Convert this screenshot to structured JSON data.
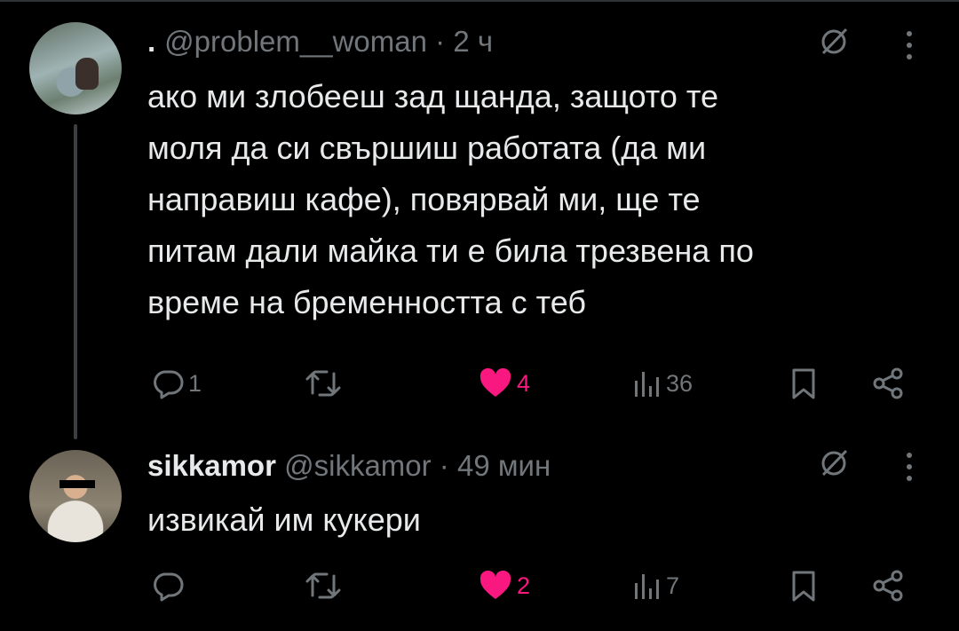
{
  "replies": [
    {
      "lead": ".",
      "display_name": "",
      "handle": "@problem__woman",
      "separator": "·",
      "time": "2 ч",
      "text_lines": [
        "ако ми злобееш зад щанда, защото те",
        "моля да си свършиш работата (да ми",
        "направиш кафе), повярвай ми, ще те",
        "питам дали майка ти е била трезвена по",
        "време на бременността с теб"
      ],
      "stats": {
        "replies": "1",
        "reposts": "",
        "likes": "4",
        "views": "36",
        "liked": true
      }
    },
    {
      "display_name": "sikkamor",
      "handle": "@sikkamor",
      "separator": "·",
      "time": "49 мин",
      "text": "извикай им кукери",
      "stats": {
        "replies": "",
        "reposts": "",
        "likes": "2",
        "views": "7",
        "liked": true
      }
    }
  ],
  "icons": {
    "reply": "speech-bubble-icon",
    "repost": "repost-arrows-icon",
    "like": "heart-icon",
    "views": "bar-chart-icon",
    "bookmark": "bookmark-icon",
    "share": "share-icon",
    "grok": "slashed-circle-icon",
    "more": "vertical-ellipsis-icon"
  },
  "colors": {
    "background": "#000000",
    "text": "#e7e9ea",
    "muted": "#71767b",
    "like": "#f91880",
    "thread_line": "#3b3f43"
  }
}
